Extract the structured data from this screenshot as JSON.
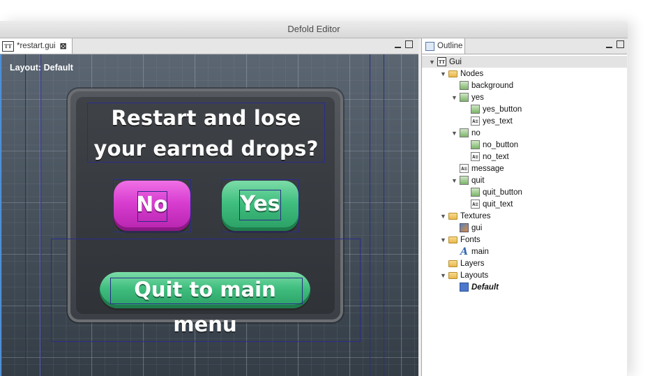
{
  "window": {
    "title": "Defold Editor"
  },
  "editor": {
    "tab": {
      "icon": "tt-gui-icon",
      "label": "*restart.gui"
    },
    "layout_label": "Layout: Default",
    "message": "Restart and lose your earned drops?",
    "buttons": {
      "no": "No",
      "yes": "Yes",
      "quit": "Quit to main menu"
    },
    "colors": {
      "no_button": "#d73ccf",
      "yes_button": "#3fbe7e",
      "quit_button": "#3fbe7e"
    }
  },
  "outline": {
    "tab_label": "Outline",
    "items": [
      {
        "label": "Gui",
        "icon": "tt-icon"
      },
      {
        "label": "Nodes",
        "icon": "folder-icon"
      },
      {
        "label": "background",
        "icon": "box-node-icon"
      },
      {
        "label": "yes",
        "icon": "box-node-icon"
      },
      {
        "label": "yes_button",
        "icon": "box-node-icon"
      },
      {
        "label": "yes_text",
        "icon": "text-node-icon"
      },
      {
        "label": "no",
        "icon": "box-node-icon"
      },
      {
        "label": "no_button",
        "icon": "box-node-icon"
      },
      {
        "label": "no_text",
        "icon": "text-node-icon"
      },
      {
        "label": "message",
        "icon": "text-node-icon"
      },
      {
        "label": "quit",
        "icon": "box-node-icon"
      },
      {
        "label": "quit_button",
        "icon": "box-node-icon"
      },
      {
        "label": "quit_text",
        "icon": "text-node-icon"
      },
      {
        "label": "Textures",
        "icon": "folder-icon"
      },
      {
        "label": "gui",
        "icon": "texture-icon"
      },
      {
        "label": "Fonts",
        "icon": "folder-icon"
      },
      {
        "label": "main",
        "icon": "font-icon"
      },
      {
        "label": "Layers",
        "icon": "folder-icon"
      },
      {
        "label": "Layouts",
        "icon": "folder-icon"
      },
      {
        "label": "Default",
        "icon": "layout-icon"
      }
    ]
  }
}
